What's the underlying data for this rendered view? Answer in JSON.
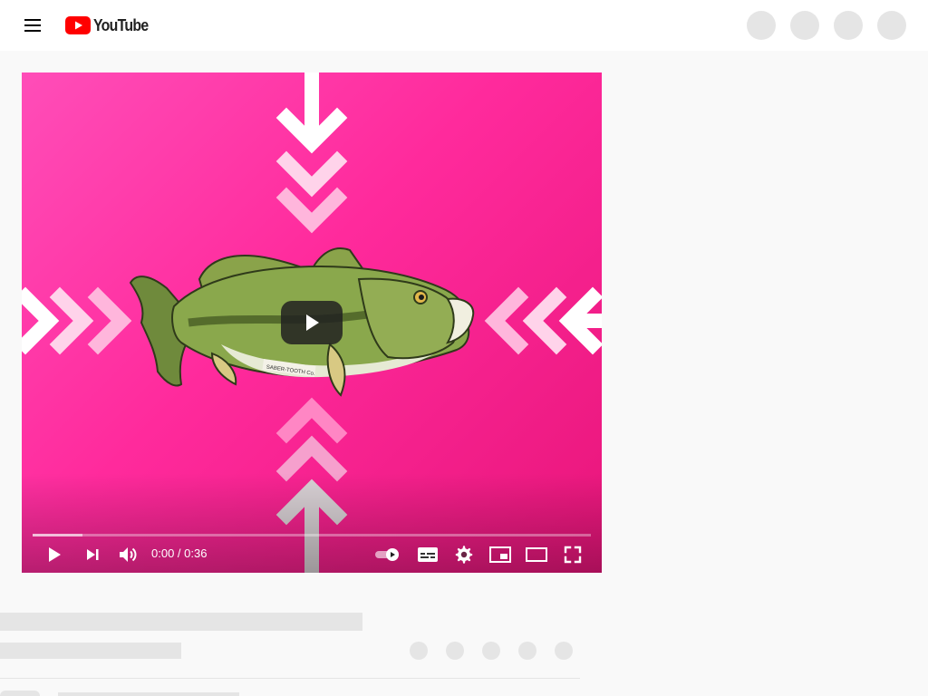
{
  "masthead": {
    "logo_text": "YouTube",
    "menu_icon": "hamburger-menu-icon",
    "brand_color": "#ff0000",
    "action_placeholders": 4
  },
  "player": {
    "time_current": "0:00",
    "time_separator": " / ",
    "time_total": "0:36",
    "buffered_fraction": 0.09,
    "thumbnail_stamp": "SABER-TOOTH Co.",
    "background_color": "#ff2a9c",
    "controls": {
      "play": "play-icon",
      "next": "next-icon",
      "volume": "volume-icon",
      "autoplay": "autoplay-toggle-icon",
      "subtitles": "subtitles-icon",
      "settings": "gear-icon",
      "miniplayer": "miniplayer-icon",
      "theater": "theater-mode-icon",
      "fullscreen": "fullscreen-icon"
    }
  },
  "below_player": {
    "placeholder_color": "#e5e5e5",
    "action_placeholders": 5
  }
}
